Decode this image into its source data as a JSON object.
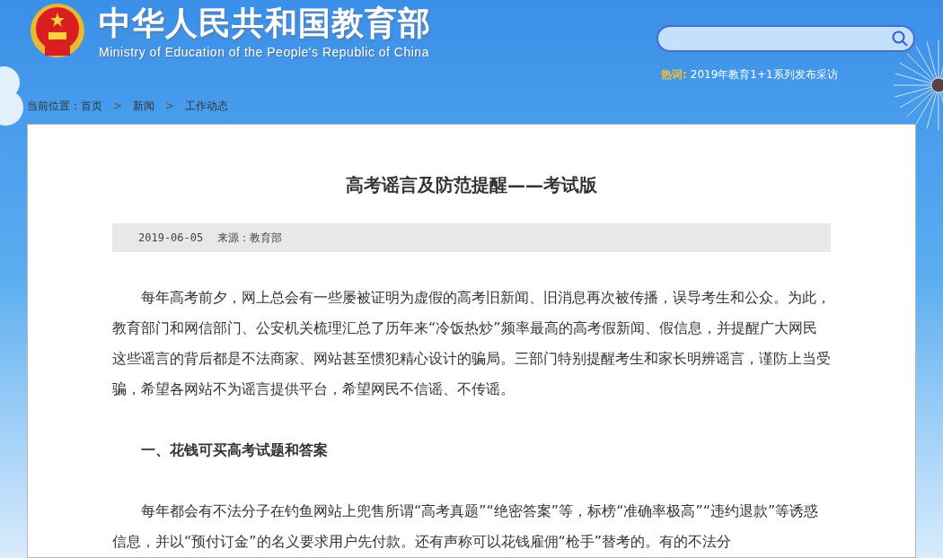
{
  "header": {
    "title_zh": "中华人民共和国教育部",
    "title_en": "Ministry of Education of the People's Republic of China",
    "hot_words": {
      "label": "热词:",
      "link": "2019年教育1+1系列发布采访"
    }
  },
  "breadcrumb": {
    "label": "当前位置：",
    "items": [
      "首页",
      "新闻",
      "工作动态"
    ],
    "separator": ">"
  },
  "article": {
    "title": "高考谣言及防范提醒——考试版",
    "date": "2019-06-05",
    "source": "来源：教育部",
    "blocks": [
      {
        "kind": "paragraph",
        "text": "每年高考前夕，网上总会有一些屡被证明为虚假的高考旧新闻、旧消息再次被传播，误导考生和公众。为此，教育部门和网信部门、公安机关梳理汇总了历年来“冷饭热炒”频率最高的高考假新闻、假信息，并提醒广大网民这些谣言的背后都是不法商家、网站甚至惯犯精心设计的骗局。三部门特别提醒考生和家长明辨谣言，谨防上当受骗，希望各网站不为谣言提供平台，希望网民不信谣、不传谣。"
      },
      {
        "kind": "heading",
        "text": "一、花钱可买高考试题和答案"
      },
      {
        "kind": "paragraph",
        "text": "每年都会有不法分子在钓鱼网站上兜售所谓“高考真题”“绝密答案”等，标榜“准确率极高”“违约退款”等诱惑信息，并以“预付订金”的名义要求用户先付款。还有声称可以花钱雇佣“枪手”替考的。有的不法分"
      }
    ]
  }
}
